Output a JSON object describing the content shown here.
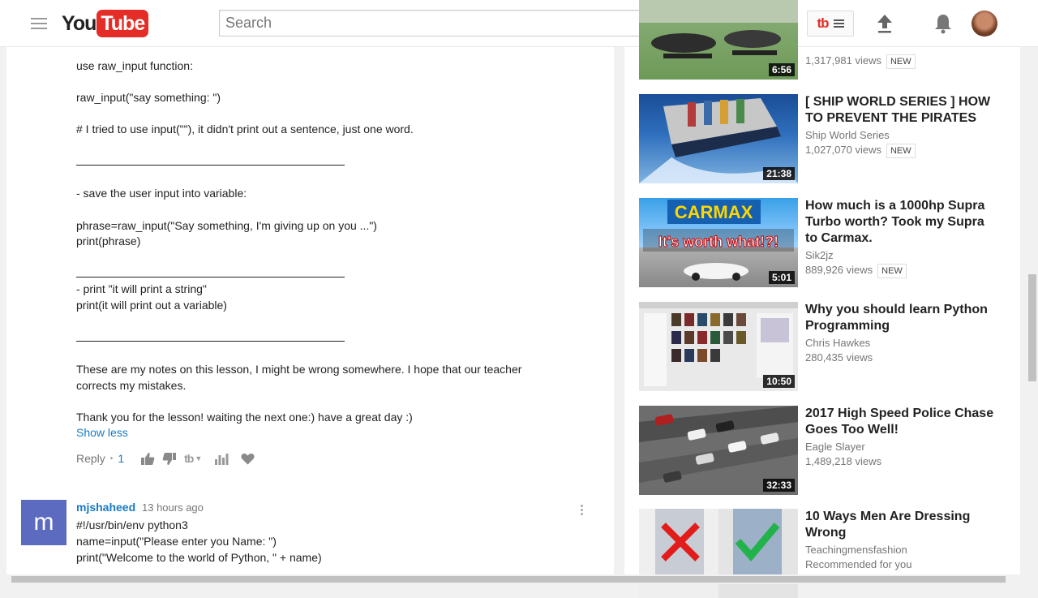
{
  "masthead": {
    "logo_you": "You",
    "logo_tube": "Tube",
    "search_placeholder": "Search",
    "tb_label": "tb"
  },
  "comment1": {
    "lines": [
      "use raw_input function:",
      "raw_input(\"say something:  \")",
      "# I tried to use input(\"\"), it didn't print out a sentence, just one word.",
      "- save the user input into variable:",
      "phrase=raw_input(\"Say something, I'm giving up on you ...\")",
      "print(phrase)",
      "- print \"it will print a string\"",
      "print(it will print out a variable)",
      "These are my notes on this lesson, I might be wrong somewhere. I hope that our teacher",
      "corrects my mistakes.",
      "Thank you for the lesson! waiting the next one:) have a great day :)"
    ],
    "show_less": "Show less",
    "reply": "Reply",
    "dot": "•",
    "likes": "1",
    "tb_label": "tb"
  },
  "comment2": {
    "avatar_letter": "m",
    "author": "mjshaheed",
    "time": "13 hours ago",
    "lines": [
      "#!/usr/bin/env python3",
      "name=input(\"Please enter you Name: \")",
      "print(\"Welcome to the world of Python, \" + name)"
    ]
  },
  "sidebar": {
    "videos": [
      {
        "title": "",
        "channel": "",
        "views": "1,317,981 views",
        "badge": "NEW",
        "duration": "6:56",
        "icon": "helicopter-thumbnail"
      },
      {
        "title": "[ SHIP WORLD SERIES ] HOW TO PREVENT THE PIRATES",
        "channel": "Ship World Series",
        "views": "1,027,070 views",
        "badge": "NEW",
        "duration": "21:38",
        "icon": "ship-thumbnail"
      },
      {
        "title": "How much is a 1000hp Supra Turbo worth? Took my Supra to Carmax.",
        "channel": "Sik2jz",
        "views": "889,926 views",
        "badge": "NEW",
        "duration": "5:01",
        "icon": "carmax-thumbnail",
        "thumb_text_1": "CARMAX",
        "thumb_text_2": "It's worth what!?!"
      },
      {
        "title": "Why you should learn Python Programming",
        "channel": "Chris Hawkes",
        "views": "280,435 views",
        "badge": "",
        "duration": "10:50",
        "icon": "website-thumbnail"
      },
      {
        "title": "2017 High Speed Police Chase Goes Too Well!",
        "channel": "Eagle Slayer",
        "views": "1,489,218 views",
        "badge": "",
        "duration": "32:33",
        "icon": "highway-thumbnail"
      },
      {
        "title": "10 Ways Men Are Dressing Wrong",
        "channel": "Teachingmensfashion",
        "views": "Recommended for you",
        "badge": "",
        "duration": "",
        "icon": "fashion-thumbnail"
      }
    ]
  },
  "colors": {
    "brand_red": "#e52d27",
    "link_blue": "#167ac6",
    "avatar_indigo": "#5c6bc0"
  }
}
